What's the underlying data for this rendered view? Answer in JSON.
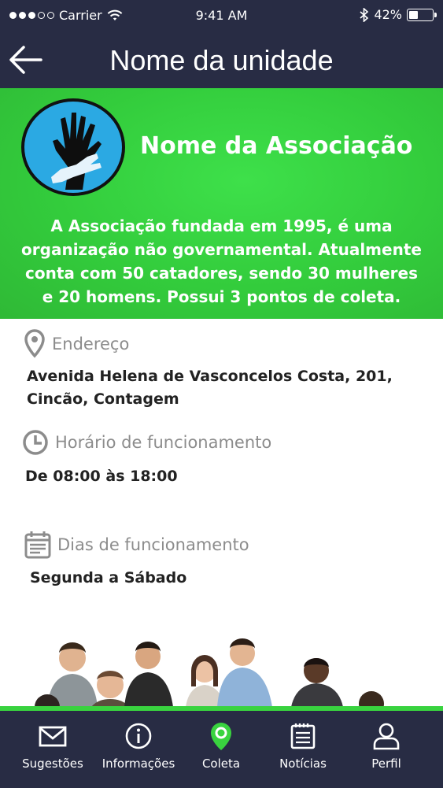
{
  "status_bar": {
    "carrier": "Carrier",
    "time": "9:41 AM",
    "battery_percent": "42%",
    "battery_level": 0.42,
    "signal_bars_filled": 3,
    "signal_bars_total": 5
  },
  "header": {
    "title": "Nome da unidade",
    "back_icon": "arrow-left-icon"
  },
  "association": {
    "name": "Nome da Associação",
    "description": "A Associação fundada em 1995, é uma organização não governamental. Atualmente conta com 50 catadores, sendo 30 mulheres e 20 homens. Possui 3 pontos de coleta.",
    "logo_icon": "helping-hands-icon"
  },
  "info": {
    "address": {
      "label": "Endereço",
      "value": "Avenida Helena de Vasconcelos Costa, 201, Cincão, Contagem",
      "icon": "map-pin-icon"
    },
    "hours": {
      "label": "Horário de funcionamento",
      "value": "De 08:00 às 18:00",
      "icon": "clock-icon"
    },
    "days": {
      "label": "Dias de funcionamento",
      "value": "Segunda a Sábado",
      "icon": "calendar-icon"
    }
  },
  "bottom_nav": {
    "items": [
      {
        "label": "Sugestões",
        "icon": "envelope-icon"
      },
      {
        "label": "Informações",
        "icon": "info-icon"
      },
      {
        "label": "Coleta",
        "icon": "map-pin-icon",
        "active": true
      },
      {
        "label": "Notícias",
        "icon": "news-icon"
      },
      {
        "label": "Perfil",
        "icon": "user-icon"
      }
    ]
  },
  "colors": {
    "header_bg": "#282c44",
    "banner_green": "#33cc3c",
    "active_nav": "#39d33f",
    "muted_label": "#8c8c8c"
  }
}
